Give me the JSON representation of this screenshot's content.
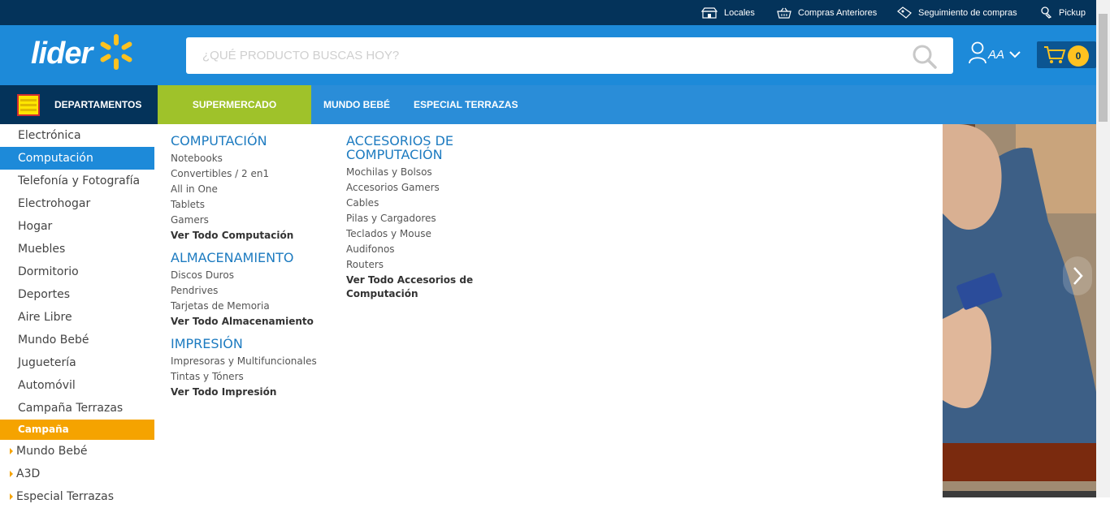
{
  "topbar": {
    "links": [
      {
        "label": "Locales",
        "icon": "store-icon"
      },
      {
        "label": "Compras Anteriores",
        "icon": "basket-icon"
      },
      {
        "label": "Seguimiento de compras",
        "icon": "tracking-icon"
      },
      {
        "label": "Pickup",
        "icon": "pickup-icon"
      }
    ]
  },
  "header": {
    "logo_text": "lider",
    "search_placeholder": "¿QUÉ PRODUCTO BUSCAS HOY?",
    "user_label": "AA",
    "cart_count": "0",
    "colors": {
      "brand_blue": "#1d8ad9",
      "dark_navy": "#04335a",
      "spark_yellow": "#ffc220"
    }
  },
  "nav": {
    "departments_label": "DEPARTAMENTOS",
    "supermercado_label": "SUPERMERCADO",
    "links": [
      "MUNDO BEBÉ",
      "ESPECIAL TERRAZAS"
    ]
  },
  "sidebar": {
    "items": [
      "Electrónica",
      "Computación",
      "Telefonía y Fotografía",
      "Electrohogar",
      "Hogar",
      "Muebles",
      "Dormitorio",
      "Deportes",
      "Aire Libre",
      "Mundo Bebé",
      "Juguetería",
      "Automóvil",
      "Campaña Terrazas"
    ],
    "active_index": 1,
    "campaign_header": "Campaña",
    "campaign_items": [
      "Mundo Bebé",
      "A3D",
      "Especial Terrazas"
    ]
  },
  "mega": {
    "col1": [
      {
        "title": "COMPUTACIÓN",
        "links": [
          "Notebooks",
          "Convertibles / 2 en1",
          "All in One",
          "Tablets",
          "Gamers"
        ],
        "all": "Ver Todo Computación"
      },
      {
        "title": "ALMACENAMIENTO",
        "links": [
          "Discos Duros",
          "Pendrives",
          "Tarjetas de Memoria"
        ],
        "all": "Ver Todo Almacenamiento"
      },
      {
        "title": "IMPRESIÓN",
        "links": [
          "Impresoras y Multifuncionales",
          "Tintas y Tóners"
        ],
        "all": "Ver Todo Impresión"
      }
    ],
    "col2": [
      {
        "title": "ACCESORIOS DE COMPUTACIÓN",
        "links": [
          "Mochilas y Bolsos",
          "Accesorios Gamers",
          "Cables",
          "Pilas y Cargadores",
          "Teclados y Mouse",
          "Audifonos",
          "Routers"
        ],
        "all": "Ver Todo Accesorios de Computación"
      }
    ]
  }
}
